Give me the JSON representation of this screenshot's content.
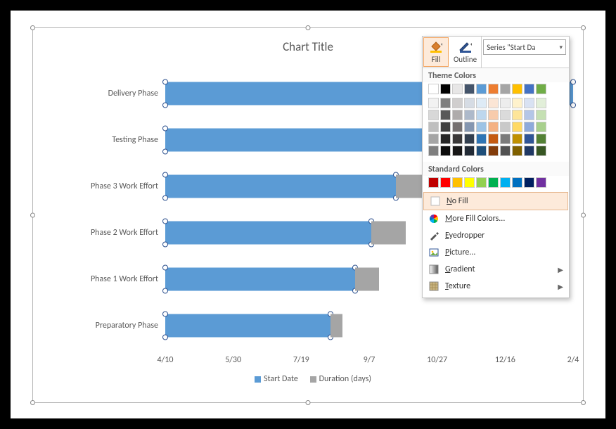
{
  "chart_data": {
    "type": "bar",
    "orientation": "horizontal",
    "stacked": true,
    "title": "Chart Title",
    "x_ticks": [
      "4/10",
      "5/30",
      "7/19",
      "9/7",
      "10/27",
      "12/16",
      "2/4"
    ],
    "categories": [
      "Delivery Phase",
      "Testing Phase",
      "Phase 3 Work Effort",
      "Phase 2 Work Effort",
      "Phase 1 Work Effort",
      "Preparatory Phase"
    ],
    "series": [
      {
        "name": "Start Date",
        "color": "#5B9BD5",
        "selected": true,
        "values_fraction": [
          1.0,
          0.685,
          0.565,
          0.505,
          0.465,
          0.405
        ]
      },
      {
        "name": "Duration (days)",
        "color": "#A5A5A5",
        "values_fraction": [
          0.0,
          0.105,
          0.085,
          0.085,
          0.06,
          0.03
        ]
      }
    ],
    "legend": [
      "Start Date",
      "Duration (days)"
    ]
  },
  "chart": {
    "title": "Chart Title",
    "categories": {
      "0": "Delivery Phase",
      "1": "Testing Phase",
      "2": "Phase 3 Work Effort",
      "3": "Phase 2 Work Effort",
      "4": "Phase 1 Work Effort",
      "5": "Preparatory Phase"
    },
    "x_ticks": {
      "0": "4/10",
      "1": "5/30",
      "2": "7/19",
      "3": "9/7",
      "4": "10/27",
      "5": "12/16",
      "6": "2/4"
    },
    "legend": {
      "a": "Start Date",
      "b": "Duration (days)"
    }
  },
  "popup": {
    "fill_label": "Fill",
    "outline_label": "Outline",
    "combo_value": "Series \"Start Da",
    "section_theme": "Theme Colors",
    "section_standard": "Standard Colors",
    "no_fill": "No Fill",
    "more_colors": "More Fill Colors...",
    "eyedropper": "Eyedropper",
    "picture": "Picture...",
    "gradient": "Gradient",
    "texture": "Texture",
    "theme_row0": [
      "#FFFFFF",
      "#000000",
      "#E7E6E6",
      "#44546A",
      "#5B9BD5",
      "#ED7D31",
      "#A5A5A5",
      "#FFC000",
      "#4472C4",
      "#70AD47"
    ],
    "theme_shades": [
      [
        "#F2F2F2",
        "#7F7F7F",
        "#D0CECE",
        "#D6DCE4",
        "#DEEBF6",
        "#FBE5D5",
        "#EDEDED",
        "#FFF2CC",
        "#D9E2F3",
        "#E2EFD9"
      ],
      [
        "#D8D8D8",
        "#595959",
        "#AEABAB",
        "#ADB9CA",
        "#BDD7EE",
        "#F7CBAC",
        "#DBDBDB",
        "#FEE599",
        "#B4C6E7",
        "#C5E0B3"
      ],
      [
        "#BFBFBF",
        "#3F3F3F",
        "#757070",
        "#8496B0",
        "#9CC3E5",
        "#F4B183",
        "#C9C9C9",
        "#FFD965",
        "#8EAADB",
        "#A8D08D"
      ],
      [
        "#A5A5A5",
        "#262626",
        "#3A3838",
        "#323F4F",
        "#2E75B5",
        "#C55A11",
        "#7B7B7B",
        "#BF9000",
        "#2F5496",
        "#538135"
      ],
      [
        "#7F7F7F",
        "#0C0C0C",
        "#171616",
        "#222A35",
        "#1E4E79",
        "#833C0B",
        "#525252",
        "#7F6000",
        "#1F3864",
        "#375623"
      ]
    ],
    "standard": [
      "#C00000",
      "#FF0000",
      "#FFC000",
      "#FFFF00",
      "#92D050",
      "#00B050",
      "#00B0F0",
      "#0070C0",
      "#002060",
      "#7030A0"
    ]
  }
}
